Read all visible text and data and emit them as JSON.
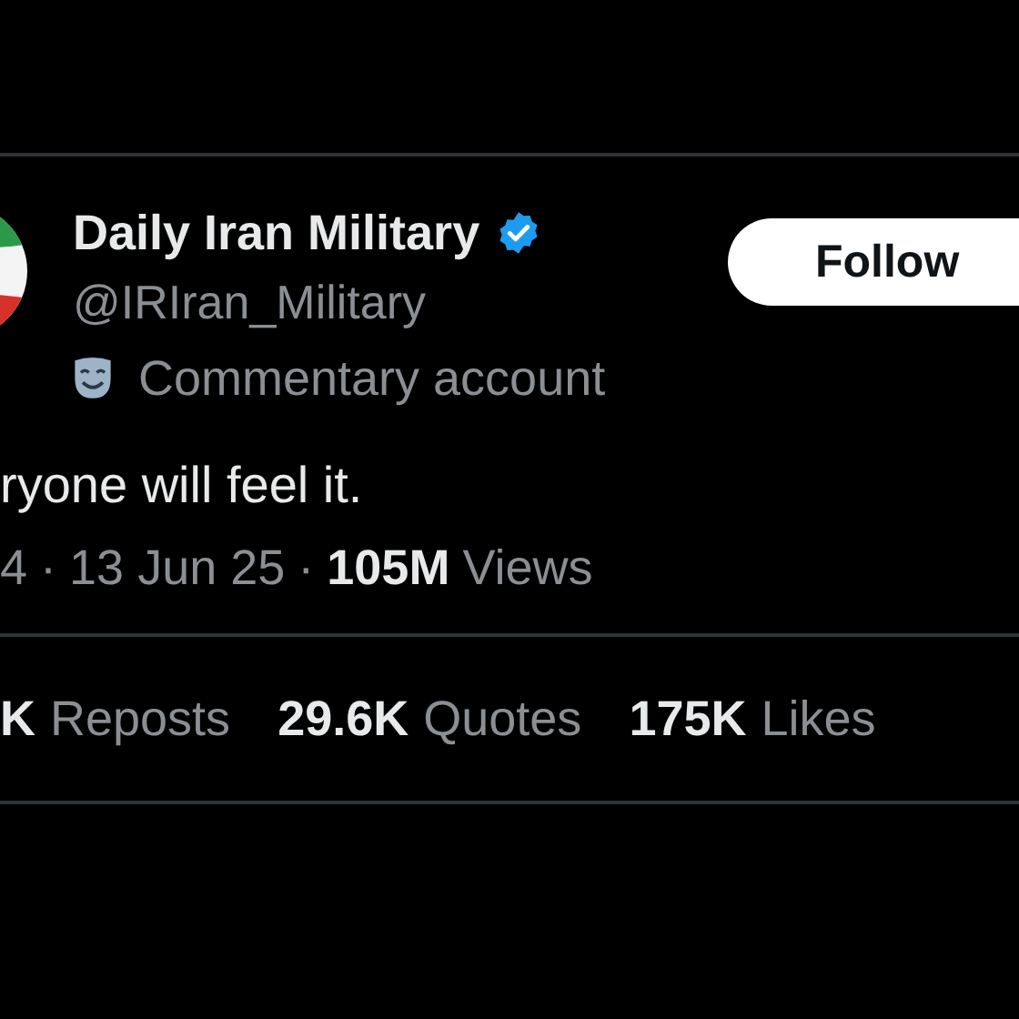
{
  "author": {
    "name": "Daily Iran Military",
    "verified": true,
    "handle": "@IRIran_Military",
    "label": "Commentary account"
  },
  "follow_button": "Follow",
  "text": "ryone will feel it.",
  "meta": [
    {
      "kind": "plain",
      "text": "4"
    },
    {
      "kind": "sep",
      "text": "·"
    },
    {
      "kind": "plain",
      "text": "13 Jun 25"
    },
    {
      "kind": "sep",
      "text": "·"
    },
    {
      "kind": "bold",
      "text": "105M"
    },
    {
      "kind": "plain",
      "text": "Views"
    }
  ],
  "stats": [
    {
      "count": "K",
      "label": "Reposts"
    },
    {
      "count": "29.6K",
      "label": "Quotes"
    },
    {
      "count": "175K",
      "label": "Likes"
    }
  ]
}
